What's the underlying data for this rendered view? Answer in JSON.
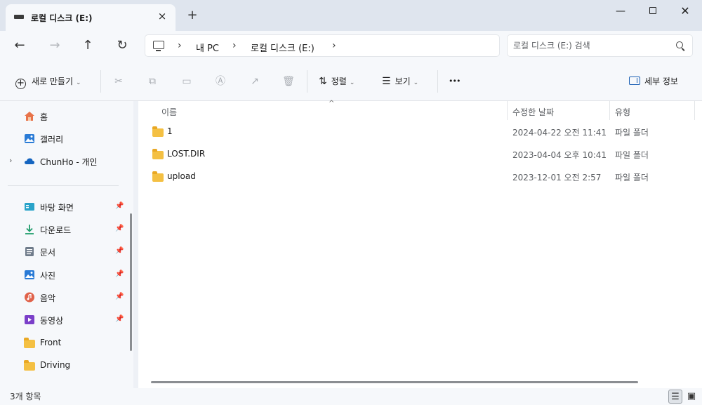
{
  "tab": {
    "title": "로컬 디스크 (E:)"
  },
  "window": {
    "minimize": "—",
    "close": "✕"
  },
  "nav": {
    "back": "←",
    "forward": "→",
    "up": "↑",
    "refresh": "↻"
  },
  "breadcrumb": {
    "items": [
      "내 PC",
      "로컬 디스크 (E:)"
    ],
    "separator": "›"
  },
  "search": {
    "placeholder": "로컬 디스크 (E:) 검색"
  },
  "toolbar": {
    "new_label": "새로 만들기",
    "sort_label": "정렬",
    "view_label": "보기",
    "more_label": "•••",
    "details_label": "세부 정보"
  },
  "sidebar": {
    "top": [
      {
        "label": "홈",
        "icon": "home-icon"
      },
      {
        "label": "갤러리",
        "icon": "gallery-icon"
      },
      {
        "label": "ChunHo - 개인",
        "icon": "onedrive-icon"
      }
    ],
    "quick": [
      {
        "label": "바탕 화면",
        "icon": "desktop-icon",
        "pinned": true
      },
      {
        "label": "다운로드",
        "icon": "download-icon",
        "pinned": true
      },
      {
        "label": "문서",
        "icon": "documents-icon",
        "pinned": true
      },
      {
        "label": "사진",
        "icon": "pictures-icon",
        "pinned": true
      },
      {
        "label": "음악",
        "icon": "music-icon",
        "pinned": true
      },
      {
        "label": "동영상",
        "icon": "videos-icon",
        "pinned": true
      },
      {
        "label": "Front",
        "icon": "folder-icon",
        "pinned": false
      },
      {
        "label": "Driving",
        "icon": "folder-icon",
        "pinned": false
      }
    ]
  },
  "columns": {
    "name": "이름",
    "date": "수정한 날짜",
    "type": "유형"
  },
  "files": [
    {
      "name": "1",
      "date": "2024-04-22 오전 11:41",
      "type": "파일 폴더"
    },
    {
      "name": "LOST.DIR",
      "date": "2023-04-04 오후 10:41",
      "type": "파일 폴더"
    },
    {
      "name": "upload",
      "date": "2023-12-01 오전 2:57",
      "type": "파일 폴더"
    }
  ],
  "status": {
    "item_count": "3개 항목"
  }
}
